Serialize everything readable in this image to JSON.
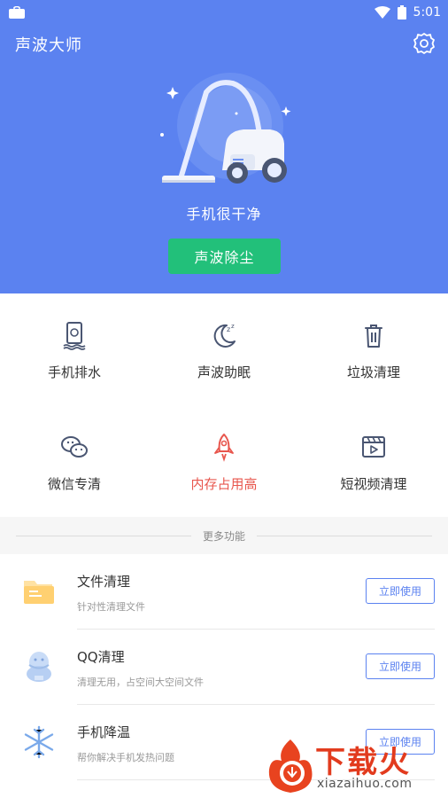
{
  "status_bar": {
    "time": "5:01"
  },
  "header": {
    "title": "声波大师"
  },
  "hero": {
    "status": "手机很干净",
    "action_label": "声波除尘"
  },
  "grid": [
    {
      "label": "手机排水",
      "icon": "drain-phone-icon"
    },
    {
      "label": "声波助眠",
      "icon": "moon-sleep-icon"
    },
    {
      "label": "垃圾清理",
      "icon": "trash-icon"
    },
    {
      "label": "微信专清",
      "icon": "wechat-icon"
    },
    {
      "label": "内存占用高",
      "icon": "rocket-icon",
      "alert": true
    },
    {
      "label": "短视频清理",
      "icon": "video-icon"
    }
  ],
  "more": {
    "label": "更多功能"
  },
  "list": [
    {
      "title": "文件清理",
      "subtitle": "针对性清理文件",
      "button": "立即使用",
      "icon": "folder-icon"
    },
    {
      "title": "QQ清理",
      "subtitle": "清理无用，占空间大空间文件",
      "button": "立即使用",
      "icon": "qq-penguin-icon"
    },
    {
      "title": "手机降温",
      "subtitle": "帮你解决手机发热问题",
      "button": "立即使用",
      "icon": "snowflake-icon"
    }
  ],
  "watermark": {
    "text": "下载火",
    "url": "xiazaihuo.com"
  },
  "colors": {
    "primary": "#5b82f0",
    "accent_green": "#22c07a",
    "alert_red": "#e8574e"
  }
}
